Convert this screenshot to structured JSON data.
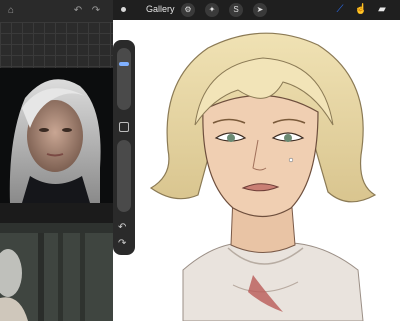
{
  "canvas": {
    "gallery_label": "Gallery",
    "accent_color": "#2b72ff"
  },
  "icons": {
    "left_top": [
      "lock-icon",
      "undo-icon",
      "redo-icon"
    ],
    "actions": [
      "wrench-icon",
      "adjust-icon",
      "selection-icon",
      "move-icon"
    ],
    "tools": [
      "brush-icon",
      "smudge-icon",
      "eraser-icon"
    ]
  }
}
